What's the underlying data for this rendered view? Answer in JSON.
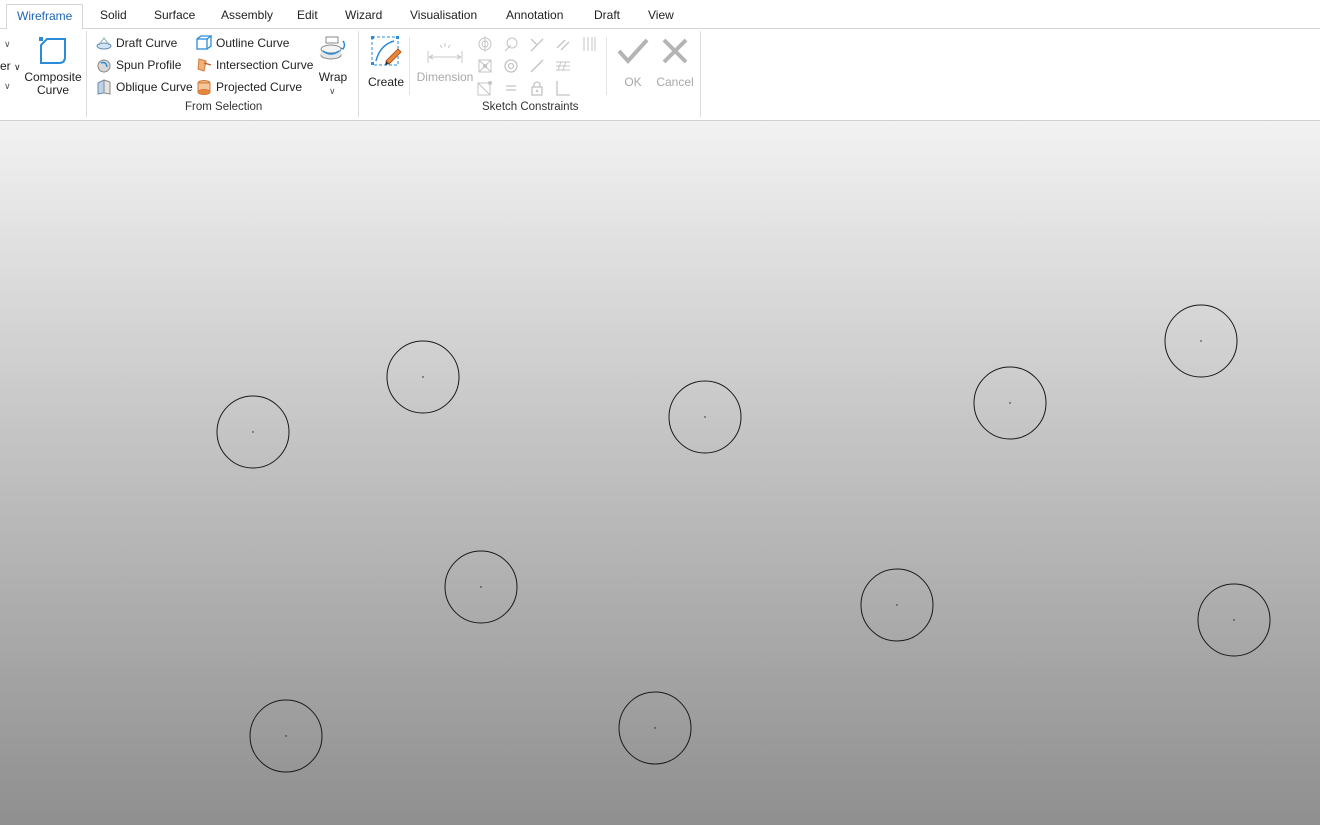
{
  "tabs": [
    {
      "label": "Wireframe",
      "active": true
    },
    {
      "label": "Solid"
    },
    {
      "label": "Surface"
    },
    {
      "label": "Assembly"
    },
    {
      "label": "Edit"
    },
    {
      "label": "Wizard"
    },
    {
      "label": "Visualisation"
    },
    {
      "label": "Annotation"
    },
    {
      "label": "Draft"
    },
    {
      "label": "View"
    }
  ],
  "ribbon": {
    "clipped_label": "er",
    "composite_curve": {
      "line1": "Composite",
      "line2": "Curve"
    },
    "from_selection": {
      "label": "From Selection",
      "items": [
        "Draft Curve",
        "Spun Profile",
        "Oblique Curve",
        "Outline Curve",
        "Intersection Curve",
        "Projected Curve"
      ],
      "wrap": "Wrap"
    },
    "sketch_constraints": {
      "label": "Sketch Constraints",
      "create": "Create",
      "dimension": "Dimension",
      "ok": "OK",
      "cancel": "Cancel"
    }
  },
  "colors": {
    "accent": "#1e64b4",
    "icon_blue": "#2a8bd8",
    "icon_orange": "#e8883a",
    "disabled": "#a8a8a8",
    "circle_stroke": "#1a1a1a"
  }
}
